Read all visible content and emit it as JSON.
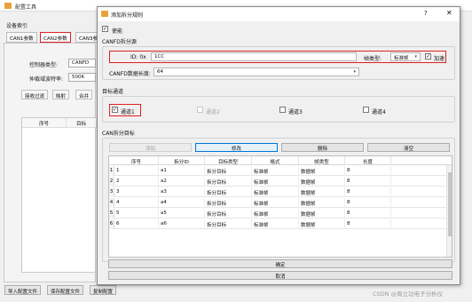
{
  "bg": {
    "title": "配置工具",
    "section_label": "设备索引",
    "tabs": [
      "CAN1参数",
      "CAN2参数",
      "CAN3参"
    ],
    "controller_label": "控制器类型:",
    "controller_value": "CANFD",
    "baud_label": "仲裁域波特率:",
    "baud_value": "500K",
    "subtabs": [
      "接收过滤",
      "映射",
      "合并"
    ],
    "table_headers": [
      "序号",
      "目标"
    ],
    "bottom_buttons": [
      "导入配置文件",
      "保存配置文件",
      "复制配置"
    ]
  },
  "dialog": {
    "title": "添加拆分规则",
    "help": "?",
    "close": "✕",
    "enable_label": "使能",
    "enable_checked": true,
    "canfd_section": "CANFD拆分源",
    "id_label": "ID: 0x",
    "id_value": "1CC",
    "frame_type_label": "帧类型:",
    "frame_type_value": "标准帧",
    "accel_label": "加速",
    "accel_checked": true,
    "data_len_label": "CANFD数据长度:",
    "data_len_value": "64",
    "target_section": "目标通道",
    "channels": [
      {
        "label": "通道1",
        "checked": true,
        "disabled": false
      },
      {
        "label": "通道2",
        "checked": false,
        "disabled": true
      },
      {
        "label": "通道3",
        "checked": false,
        "disabled": false
      },
      {
        "label": "通道4",
        "checked": false,
        "disabled": false
      }
    ],
    "can_target_section": "CAN拆分目标",
    "buttons": {
      "add": "添加",
      "modify": "修改",
      "delete": "删除",
      "clear": "清空"
    },
    "table": {
      "headers": [
        "序号",
        "拆分ID",
        "目标类型",
        "格式",
        "帧类型",
        "长度"
      ],
      "rows": [
        {
          "rn": "1",
          "seq": "1",
          "id": "a1",
          "type": "拆分目标",
          "fmt": "标准帧",
          "frame": "数据帧",
          "len": "8"
        },
        {
          "rn": "2",
          "seq": "2",
          "id": "a2",
          "type": "拆分目标",
          "fmt": "标准帧",
          "frame": "数据帧",
          "len": "8"
        },
        {
          "rn": "3",
          "seq": "3",
          "id": "a3",
          "type": "拆分目标",
          "fmt": "标准帧",
          "frame": "数据帧",
          "len": "8"
        },
        {
          "rn": "4",
          "seq": "4",
          "id": "a4",
          "type": "拆分目标",
          "fmt": "标准帧",
          "frame": "数据帧",
          "len": "8"
        },
        {
          "rn": "5",
          "seq": "5",
          "id": "a5",
          "type": "拆分目标",
          "fmt": "标准帧",
          "frame": "数据帧",
          "len": "8"
        },
        {
          "rn": "6",
          "seq": "6",
          "id": "a6",
          "type": "拆分目标",
          "fmt": "标准帧",
          "frame": "数据帧",
          "len": "8"
        }
      ]
    },
    "ok": "确定",
    "cancel": "取消"
  },
  "watermark": "CSDN @周立功电子分析仪"
}
